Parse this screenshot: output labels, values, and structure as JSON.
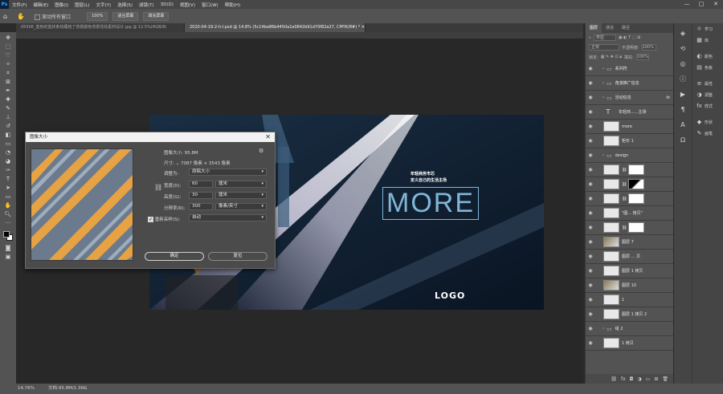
{
  "app": {
    "logo": "Ps"
  },
  "menu": [
    "文件(F)",
    "编辑(E)",
    "图像(I)",
    "图层(L)",
    "文字(Y)",
    "选择(S)",
    "滤镜(T)",
    "3D(D)",
    "视图(V)",
    "窗口(W)",
    "帮助(H)"
  ],
  "window_controls": [
    "—",
    "□",
    "✕"
  ],
  "options": {
    "scroll_all": "滚动所有窗口",
    "zoom": "100%",
    "fit": "适合屏幕",
    "fill": "填充屏幕"
  },
  "tabs": [
    {
      "label": "05506_蓝色的蓝状条纹缠绕了背景颜色背景花纹素材设计.jpg @ 12.5%(RGB/8)",
      "active": false
    },
    {
      "label": "2020-04-19-2-h-l.psd @ 14.8% (5c14be86b4450a1e0842b91d70f82a27, CMYK/8#) *",
      "active": true
    }
  ],
  "status": {
    "zoom": "14.76%",
    "doc": "文档:95.8M/1.36G"
  },
  "artwork": {
    "tag_line1": "年轻商务市芯",
    "tag_line2": "定义自己的生活主场",
    "headline": "MORE",
    "logo": "LOGO"
  },
  "dialog": {
    "title": "图像大小",
    "size_label": "图像大小:",
    "size_value": "95.8M",
    "dims_label": "尺寸:",
    "dims_value": "7087 像素 × 3543 像素",
    "fit_label": "调整为:",
    "fit_value": "原稿大小",
    "width_label": "宽度(D):",
    "width_value": "60",
    "width_unit": "厘米",
    "height_label": "高度(G):",
    "height_value": "30",
    "height_unit": "厘米",
    "res_label": "分辨率(R):",
    "res_value": "300",
    "res_unit": "像素/英寸",
    "resample_label": "重新采样(S):",
    "resample_value": "自动",
    "ok": "确定",
    "reset": "复位"
  },
  "layers_panel": {
    "tabs": [
      "图层",
      "通道",
      "路径"
    ],
    "filter": "类型",
    "blend": "正常",
    "opacity_label": "不透明度:",
    "opacity": "100%",
    "lock_label": "锁定:",
    "fill_label": "填充:",
    "fill": "100%",
    "layers": [
      {
        "name": "系列符",
        "kind": "folder"
      },
      {
        "name": "角落推广信息",
        "kind": "folder"
      },
      {
        "name": "活动信息",
        "kind": "folder",
        "fx": "fx"
      },
      {
        "name": "年轻商......主场",
        "kind": "text"
      },
      {
        "name": "more",
        "kind": "layer"
      },
      {
        "name": "矩形 1",
        "kind": "layer"
      },
      {
        "name": "design",
        "kind": "group"
      },
      {
        "name": "",
        "kind": "mask"
      },
      {
        "name": "",
        "kind": "mask"
      },
      {
        "name": "",
        "kind": "mask"
      },
      {
        "name": "\"图... 拷贝\"",
        "kind": "layer"
      },
      {
        "name": "",
        "kind": "mask"
      },
      {
        "name": "图层 7",
        "kind": "layer"
      },
      {
        "name": "图层 ... 贝",
        "kind": "layer"
      },
      {
        "name": "图层 1 拷贝",
        "kind": "layer"
      },
      {
        "name": "图层 10",
        "kind": "layer"
      },
      {
        "name": "1",
        "kind": "layer"
      },
      {
        "name": "图层 1 拷贝 2",
        "kind": "layer"
      },
      {
        "name": "组 2",
        "kind": "folder"
      },
      {
        "name": "1 拷贝",
        "kind": "layer"
      }
    ]
  },
  "right_panels": [
    {
      "icon": "bulb-icon",
      "glyph": "☼",
      "label": "学习"
    },
    {
      "icon": "library-icon",
      "glyph": "▦",
      "label": "库"
    },
    {
      "icon": "color-icon",
      "glyph": "◐",
      "label": "颜色"
    },
    {
      "icon": "swatches-icon",
      "glyph": "▤",
      "label": "色板"
    },
    {
      "icon": "properties-icon",
      "glyph": "≡",
      "label": "属性"
    },
    {
      "icon": "adjust-icon",
      "glyph": "◑",
      "label": "调整"
    },
    {
      "icon": "styles-icon",
      "glyph": "fx",
      "label": "样式"
    },
    {
      "icon": "shape-icon",
      "glyph": "◆",
      "label": "形状"
    },
    {
      "icon": "brush-icon",
      "glyph": "✎",
      "label": "画笔"
    }
  ]
}
